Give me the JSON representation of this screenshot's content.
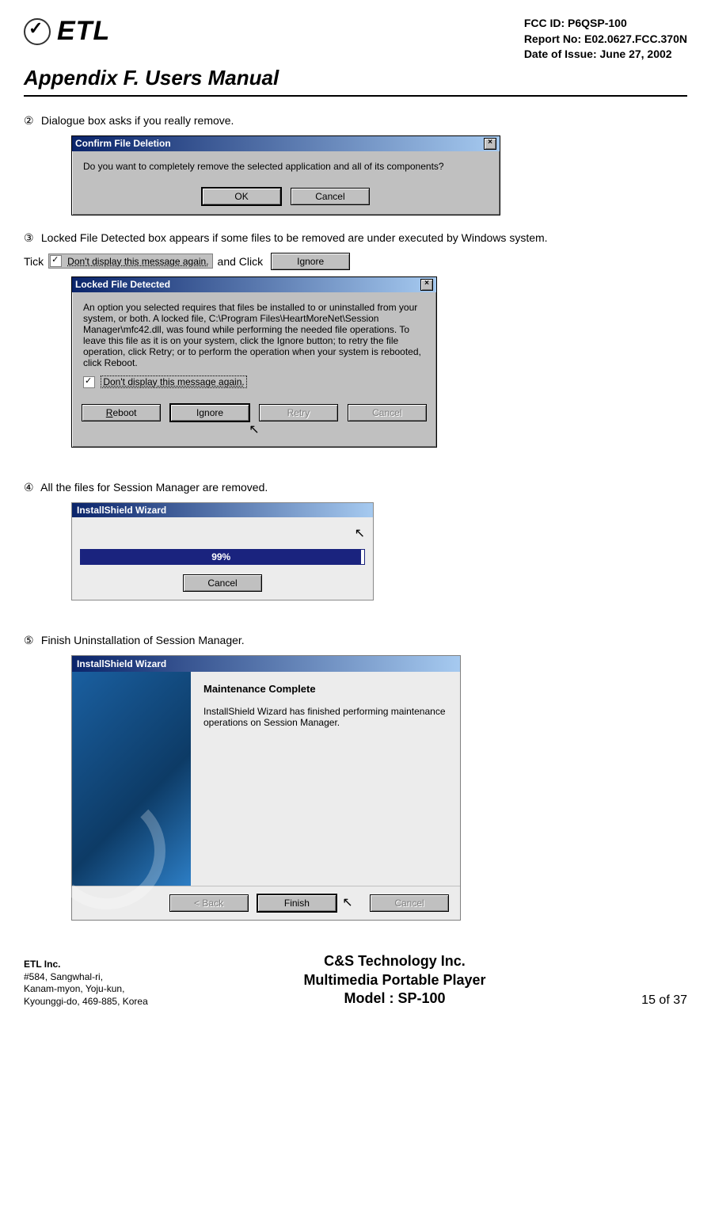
{
  "header": {
    "logo_text": "ETL",
    "fcc_id": "FCC ID: P6QSP-100",
    "report_no": "Report No: E02.0627.FCC.370N",
    "date": "Date of Issue: June 27, 2002",
    "appendix_title": "Appendix F.  Users Manual"
  },
  "steps": {
    "s2": {
      "num": "②",
      "text": "Dialogue box asks if you really remove."
    },
    "s3": {
      "num": "③",
      "text": "Locked File Detected box appears if some files to be removed are under executed by Windows system."
    },
    "s3_tick": "Tick",
    "s3_andclick": "and Click",
    "s4": {
      "num": "④",
      "text": "All the files for Session Manager are removed."
    },
    "s5": {
      "num": "⑤",
      "text": " Finish Uninstallation of Session Manager."
    }
  },
  "dlg_confirm": {
    "title": "Confirm File Deletion",
    "body": "Do you want to completely remove the selected application and all of its components?",
    "ok": "OK",
    "cancel": "Cancel"
  },
  "dlg_locked_inline": {
    "chk_label": "Don't display this message again.",
    "ignore": "Ignore"
  },
  "dlg_locked": {
    "title": "Locked File Detected",
    "body": "An option you selected requires that files be installed to or uninstalled from your system, or both. A locked file, C:\\Program Files\\HeartMoreNet\\Session Manager\\mfc42.dll, was found while performing the needed file operations. To leave this file as it is on your system, click the Ignore button; to retry the file operation, click Retry; or to perform the operation when your system is rebooted, click Reboot.",
    "chk_label": "Don't display this message again.",
    "reboot": "Reboot",
    "ignore": "Ignore",
    "retry": "Retry",
    "cancel": "Cancel"
  },
  "dlg_progress": {
    "title": "InstallShield Wizard",
    "percent": "99%",
    "cancel": "Cancel"
  },
  "dlg_finish": {
    "title": "InstallShield Wizard",
    "heading": "Maintenance Complete",
    "body": "InstallShield Wizard has finished performing maintenance operations on Session Manager.",
    "back": "< Back",
    "finish": "Finish",
    "cancel": "Cancel"
  },
  "footer": {
    "company": "ETL Inc.",
    "addr1": "#584, Sangwhal-ri,",
    "addr2": "Kanam-myon, Yoju-kun,",
    "addr3": "Kyounggi-do, 469-885, Korea",
    "center1": "C&S Technology Inc.",
    "center2": "Multimedia Portable Player",
    "center3": "Model : SP-100",
    "page": "15 of 37"
  }
}
